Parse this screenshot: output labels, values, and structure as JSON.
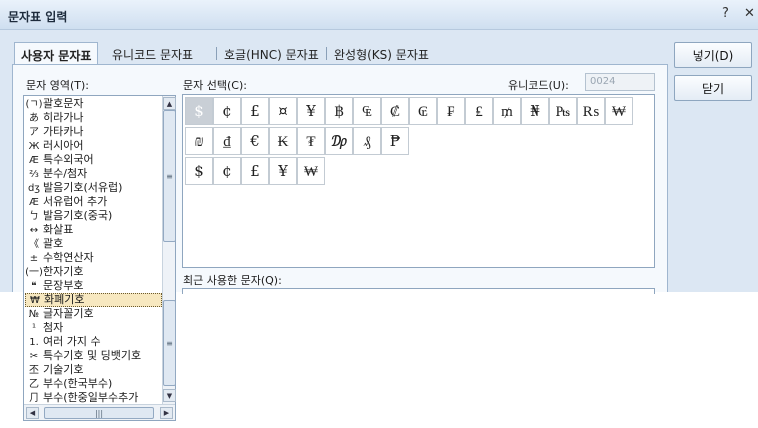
{
  "window": {
    "title": "문자표 입력",
    "help_glyph": "?",
    "close_glyph": "✕"
  },
  "tabs": [
    {
      "label": "사용자 문자표",
      "active": true
    },
    {
      "label": "유니코드 문자표",
      "active": false
    },
    {
      "label": "호글(HNC) 문자표",
      "active": false
    },
    {
      "label": "완성형(KS) 문자표",
      "active": false
    }
  ],
  "area_label": "문자 영역(T):",
  "char_select_label": "문자 선택(C):",
  "unicode": {
    "label": "유니코드(U):",
    "value": "0024"
  },
  "recent_label": "최근 사용한 문자(Q):",
  "buttons": {
    "insert": "넣기(D)",
    "close": "닫기"
  },
  "categories": [
    {
      "icon": "(ㄱ)",
      "label": "괄호문자"
    },
    {
      "icon": "あ",
      "label": "히라가나"
    },
    {
      "icon": "ア",
      "label": "가타카나"
    },
    {
      "icon": "Ж",
      "label": "러시아어"
    },
    {
      "icon": "Æ",
      "label": "특수외국어"
    },
    {
      "icon": "⅔",
      "label": "분수/첨자"
    },
    {
      "icon": "dʒ",
      "label": "발음기호(서유럽)"
    },
    {
      "icon": "Æ",
      "label": "서유럽어 추가"
    },
    {
      "icon": "ㄅ",
      "label": "발음기호(중국)"
    },
    {
      "icon": "↔",
      "label": "화살표"
    },
    {
      "icon": "《",
      "label": "괄호"
    },
    {
      "icon": "±",
      "label": "수학연산자"
    },
    {
      "icon": "(一)",
      "label": "한자기호"
    },
    {
      "icon": "❝",
      "label": "문장부호"
    },
    {
      "icon": "₩",
      "label": "화폐기호",
      "selected": true
    },
    {
      "icon": "№",
      "label": "글자꼴기호"
    },
    {
      "icon": "¹",
      "label": "첨자"
    },
    {
      "icon": "1.",
      "label": "여러 가지 수"
    },
    {
      "icon": "✂",
      "label": "특수기호 및 딩뱃기호"
    },
    {
      "icon": "丕",
      "label": "기술기호"
    },
    {
      "icon": "乙",
      "label": "부수(한국부수)"
    },
    {
      "icon": "⺆",
      "label": "부수(한중일부수추가"
    }
  ],
  "characters": [
    [
      "$",
      "¢",
      "£",
      "¤",
      "¥",
      "฿",
      "₠",
      "₡",
      "₢",
      "₣",
      "₤",
      "₥",
      "₦",
      "₧",
      "₨",
      "₩"
    ],
    [
      "₪",
      "₫",
      "€",
      "₭",
      "₮",
      "₯",
      "₰",
      "₱"
    ],
    [
      "$",
      "¢",
      "£",
      "¥",
      "₩"
    ]
  ],
  "selected_char": "$"
}
